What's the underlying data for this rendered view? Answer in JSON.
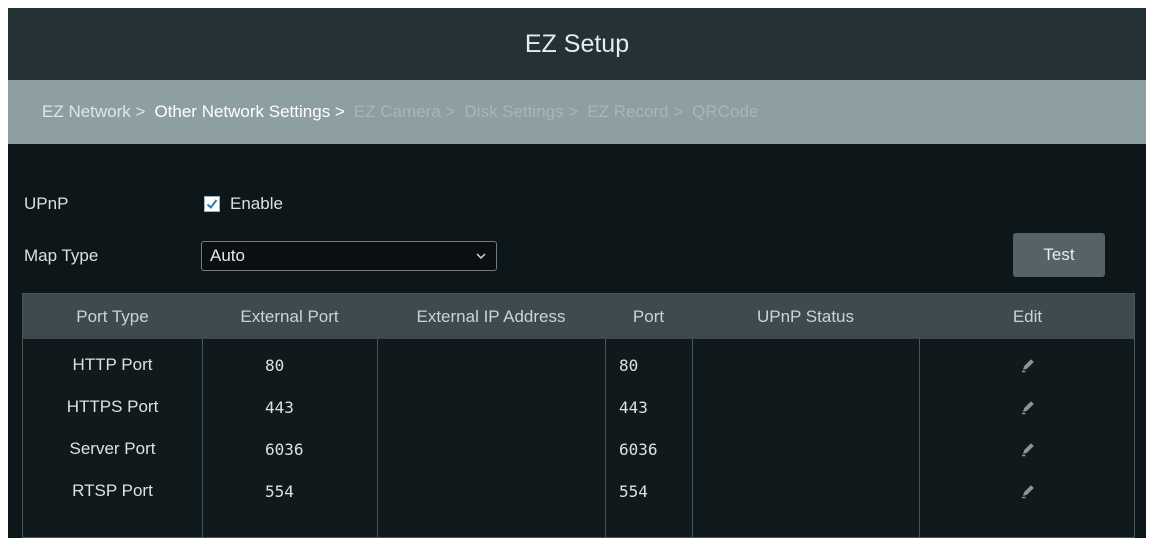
{
  "window": {
    "title": "EZ Setup"
  },
  "steps": [
    {
      "label": "EZ Network >",
      "state": "done"
    },
    {
      "label": "Other Network Settings >",
      "state": "current"
    },
    {
      "label": "EZ Camera >",
      "state": "future"
    },
    {
      "label": "Disk Settings >",
      "state": "future"
    },
    {
      "label": "EZ Record >",
      "state": "future"
    },
    {
      "label": "QRCode",
      "state": "future"
    }
  ],
  "upnp": {
    "label": "UPnP",
    "checkbox_label": "Enable",
    "checked": true
  },
  "map_type": {
    "label": "Map Type",
    "value": "Auto"
  },
  "test_button": {
    "label": "Test"
  },
  "table": {
    "headers": [
      "Port Type",
      "External Port",
      "External IP Address",
      "Port",
      "UPnP Status",
      "Edit"
    ],
    "rows": [
      {
        "port_type": "HTTP Port",
        "external_port": "80",
        "external_ip": "",
        "port": "80",
        "upnp_status": ""
      },
      {
        "port_type": "HTTPS Port",
        "external_port": "443",
        "external_ip": "",
        "port": "443",
        "upnp_status": ""
      },
      {
        "port_type": "Server Port",
        "external_port": "6036",
        "external_ip": "",
        "port": "6036",
        "upnp_status": ""
      },
      {
        "port_type": "RTSP Port",
        "external_port": "554",
        "external_ip": "",
        "port": "554",
        "upnp_status": ""
      }
    ]
  },
  "colors": {
    "accent": "#2f7dab",
    "titlebar": "#253235",
    "stepbar": "#8e9fa4",
    "background": "#0d1719"
  },
  "icons": {
    "edit": "pencil-icon",
    "dropdown": "chevron-down-icon",
    "check": "checkmark-icon"
  }
}
